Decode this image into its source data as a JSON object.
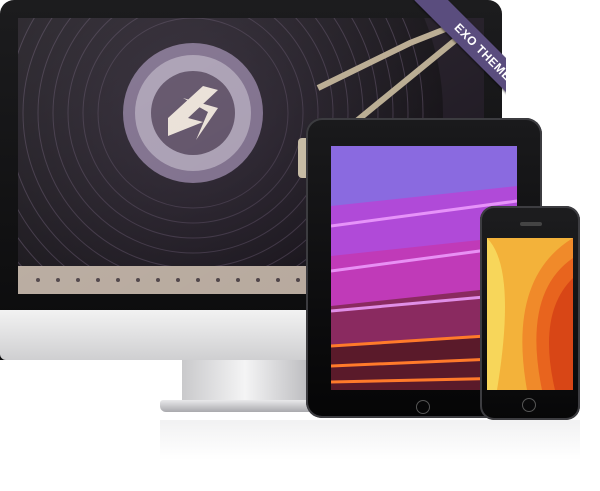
{
  "ribbon": {
    "label": "EXO THEME"
  },
  "colors": {
    "ribbon": "#5a4d7e",
    "device_bezel": "#0b0b0c",
    "monitor_chin": "#e2e2e4"
  },
  "devices": {
    "monitor": {
      "screen_content": "turntable-record-image"
    },
    "tablet": {
      "screen_content": "purple-structure-image"
    },
    "phone": {
      "screen_content": "orange-curves-image"
    }
  }
}
